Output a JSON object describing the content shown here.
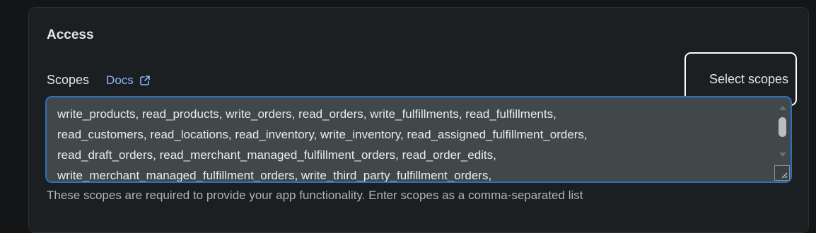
{
  "section": {
    "title": "Access"
  },
  "scopes": {
    "label": "Scopes",
    "docs_label": "Docs",
    "select_button": "Select scopes",
    "value": "write_products, read_products, write_orders, read_orders, write_fulfillments, read_fulfillments,\nread_customers, read_locations, read_inventory, write_inventory, read_assigned_fulfillment_orders,\nread_draft_orders, read_merchant_managed_fulfillment_orders, read_order_edits,\nwrite_merchant_managed_fulfillment_orders, write_third_party_fulfillment_orders,",
    "help": "These scopes are required to provide your app functionality. Enter scopes as a comma-separated list"
  },
  "icons": {
    "docs": "external-link-icon"
  },
  "colors": {
    "accent_border": "#2f6fbf",
    "link": "#8ab6ff",
    "card_bg": "#1b1f21"
  }
}
